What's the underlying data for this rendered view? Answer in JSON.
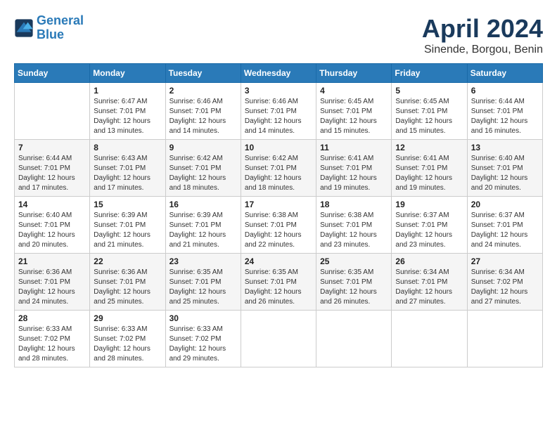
{
  "header": {
    "logo_line1": "General",
    "logo_line2": "Blue",
    "title": "April 2024",
    "subtitle": "Sinende, Borgou, Benin"
  },
  "columns": [
    "Sunday",
    "Monday",
    "Tuesday",
    "Wednesday",
    "Thursday",
    "Friday",
    "Saturday"
  ],
  "weeks": [
    {
      "days": [
        {
          "number": "",
          "info": ""
        },
        {
          "number": "1",
          "info": "Sunrise: 6:47 AM\nSunset: 7:01 PM\nDaylight: 12 hours\nand 13 minutes."
        },
        {
          "number": "2",
          "info": "Sunrise: 6:46 AM\nSunset: 7:01 PM\nDaylight: 12 hours\nand 14 minutes."
        },
        {
          "number": "3",
          "info": "Sunrise: 6:46 AM\nSunset: 7:01 PM\nDaylight: 12 hours\nand 14 minutes."
        },
        {
          "number": "4",
          "info": "Sunrise: 6:45 AM\nSunset: 7:01 PM\nDaylight: 12 hours\nand 15 minutes."
        },
        {
          "number": "5",
          "info": "Sunrise: 6:45 AM\nSunset: 7:01 PM\nDaylight: 12 hours\nand 15 minutes."
        },
        {
          "number": "6",
          "info": "Sunrise: 6:44 AM\nSunset: 7:01 PM\nDaylight: 12 hours\nand 16 minutes."
        }
      ]
    },
    {
      "days": [
        {
          "number": "7",
          "info": "Sunrise: 6:44 AM\nSunset: 7:01 PM\nDaylight: 12 hours\nand 17 minutes."
        },
        {
          "number": "8",
          "info": "Sunrise: 6:43 AM\nSunset: 7:01 PM\nDaylight: 12 hours\nand 17 minutes."
        },
        {
          "number": "9",
          "info": "Sunrise: 6:42 AM\nSunset: 7:01 PM\nDaylight: 12 hours\nand 18 minutes."
        },
        {
          "number": "10",
          "info": "Sunrise: 6:42 AM\nSunset: 7:01 PM\nDaylight: 12 hours\nand 18 minutes."
        },
        {
          "number": "11",
          "info": "Sunrise: 6:41 AM\nSunset: 7:01 PM\nDaylight: 12 hours\nand 19 minutes."
        },
        {
          "number": "12",
          "info": "Sunrise: 6:41 AM\nSunset: 7:01 PM\nDaylight: 12 hours\nand 19 minutes."
        },
        {
          "number": "13",
          "info": "Sunrise: 6:40 AM\nSunset: 7:01 PM\nDaylight: 12 hours\nand 20 minutes."
        }
      ]
    },
    {
      "days": [
        {
          "number": "14",
          "info": "Sunrise: 6:40 AM\nSunset: 7:01 PM\nDaylight: 12 hours\nand 20 minutes."
        },
        {
          "number": "15",
          "info": "Sunrise: 6:39 AM\nSunset: 7:01 PM\nDaylight: 12 hours\nand 21 minutes."
        },
        {
          "number": "16",
          "info": "Sunrise: 6:39 AM\nSunset: 7:01 PM\nDaylight: 12 hours\nand 21 minutes."
        },
        {
          "number": "17",
          "info": "Sunrise: 6:38 AM\nSunset: 7:01 PM\nDaylight: 12 hours\nand 22 minutes."
        },
        {
          "number": "18",
          "info": "Sunrise: 6:38 AM\nSunset: 7:01 PM\nDaylight: 12 hours\nand 23 minutes."
        },
        {
          "number": "19",
          "info": "Sunrise: 6:37 AM\nSunset: 7:01 PM\nDaylight: 12 hours\nand 23 minutes."
        },
        {
          "number": "20",
          "info": "Sunrise: 6:37 AM\nSunset: 7:01 PM\nDaylight: 12 hours\nand 24 minutes."
        }
      ]
    },
    {
      "days": [
        {
          "number": "21",
          "info": "Sunrise: 6:36 AM\nSunset: 7:01 PM\nDaylight: 12 hours\nand 24 minutes."
        },
        {
          "number": "22",
          "info": "Sunrise: 6:36 AM\nSunset: 7:01 PM\nDaylight: 12 hours\nand 25 minutes."
        },
        {
          "number": "23",
          "info": "Sunrise: 6:35 AM\nSunset: 7:01 PM\nDaylight: 12 hours\nand 25 minutes."
        },
        {
          "number": "24",
          "info": "Sunrise: 6:35 AM\nSunset: 7:01 PM\nDaylight: 12 hours\nand 26 minutes."
        },
        {
          "number": "25",
          "info": "Sunrise: 6:35 AM\nSunset: 7:01 PM\nDaylight: 12 hours\nand 26 minutes."
        },
        {
          "number": "26",
          "info": "Sunrise: 6:34 AM\nSunset: 7:01 PM\nDaylight: 12 hours\nand 27 minutes."
        },
        {
          "number": "27",
          "info": "Sunrise: 6:34 AM\nSunset: 7:02 PM\nDaylight: 12 hours\nand 27 minutes."
        }
      ]
    },
    {
      "days": [
        {
          "number": "28",
          "info": "Sunrise: 6:33 AM\nSunset: 7:02 PM\nDaylight: 12 hours\nand 28 minutes."
        },
        {
          "number": "29",
          "info": "Sunrise: 6:33 AM\nSunset: 7:02 PM\nDaylight: 12 hours\nand 28 minutes."
        },
        {
          "number": "30",
          "info": "Sunrise: 6:33 AM\nSunset: 7:02 PM\nDaylight: 12 hours\nand 29 minutes."
        },
        {
          "number": "",
          "info": ""
        },
        {
          "number": "",
          "info": ""
        },
        {
          "number": "",
          "info": ""
        },
        {
          "number": "",
          "info": ""
        }
      ]
    }
  ]
}
